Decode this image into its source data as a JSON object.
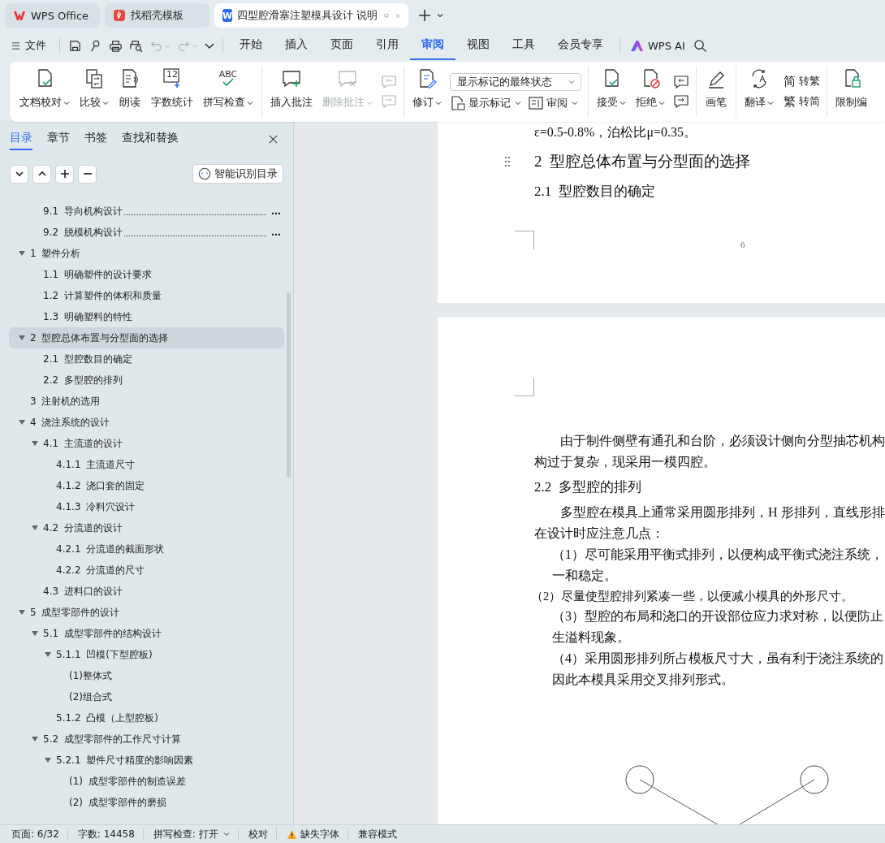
{
  "tabs": [
    {
      "label": "WPS Office",
      "selected": false,
      "kind": "wps"
    },
    {
      "label": "找稻壳模板",
      "selected": false,
      "kind": "docer"
    },
    {
      "label": "四型腔滑塞注塑模具设计 说明",
      "selected": true,
      "kind": "document",
      "logo_text": "W"
    }
  ],
  "menu": {
    "file": "文件",
    "quick_access": [
      {
        "disabled": false
      },
      {
        "disabled": false
      },
      {
        "disabled": false
      },
      {
        "disabled": false
      },
      {
        "disabled": true
      },
      {
        "disabled": true
      },
      {
        "disabled": false
      }
    ],
    "tabs": [
      {
        "label": "开始",
        "selected": false
      },
      {
        "label": "插入",
        "selected": false
      },
      {
        "label": "页面",
        "selected": false
      },
      {
        "label": "引用",
        "selected": false
      },
      {
        "label": "审阅",
        "selected": true
      },
      {
        "label": "视图",
        "selected": false
      },
      {
        "label": "工具",
        "selected": false
      },
      {
        "label": "会员专享",
        "selected": false
      }
    ],
    "ai": "WPS AI"
  },
  "ribbon": {
    "groups": [
      {
        "tools": [
          {
            "kind": "large",
            "label": "文档校对",
            "caret": true,
            "disabled": false
          },
          {
            "kind": "large",
            "label": "比较",
            "caret": true,
            "disabled": false
          },
          {
            "kind": "large",
            "label": "朗读",
            "caret": false,
            "disabled": false
          },
          {
            "kind": "large",
            "label": "字数统计",
            "caret": false,
            "disabled": false,
            "icon_text": "12"
          },
          {
            "kind": "large",
            "label": "拼写检查",
            "caret": true,
            "disabled": false,
            "icon_text": "ABC"
          }
        ]
      },
      {
        "tools": [
          {
            "kind": "large",
            "label": "插入批注",
            "caret": false,
            "disabled": false
          },
          {
            "kind": "large",
            "label": "删除批注",
            "caret": true,
            "disabled": true
          },
          {
            "kind": "stack",
            "rows": [
              [
                {
                  "kind": "icon",
                  "disabled": true
                }
              ],
              [
                {
                  "kind": "icon",
                  "disabled": true
                }
              ]
            ]
          }
        ]
      },
      {
        "tools": [
          {
            "kind": "large",
            "label": "修订",
            "caret": true,
            "disabled": false
          },
          {
            "kind": "stack",
            "rows": [
              [
                {
                  "kind": "select",
                  "value": "显示标记的最终状态"
                }
              ],
              [
                {
                  "kind": "small",
                  "label": "显示标记",
                  "caret": true,
                  "disabled": false
                },
                {
                  "kind": "small",
                  "label": "审阅",
                  "caret": true,
                  "disabled": false
                }
              ]
            ]
          }
        ]
      },
      {
        "tools": [
          {
            "kind": "large",
            "label": "接受",
            "caret": true,
            "disabled": false
          },
          {
            "kind": "large",
            "label": "拒绝",
            "caret": true,
            "disabled": false
          },
          {
            "kind": "stack",
            "rows": [
              [
                {
                  "kind": "icon",
                  "disabled": false
                }
              ],
              [
                {
                  "kind": "icon",
                  "disabled": false
                }
              ]
            ]
          }
        ]
      },
      {
        "tools": [
          {
            "kind": "large",
            "label": "画笔",
            "caret": false,
            "disabled": false
          }
        ]
      },
      {
        "tools": [
          {
            "kind": "large",
            "label": "翻译",
            "caret": true,
            "disabled": false
          },
          {
            "kind": "stack",
            "rows": [
              [
                {
                  "kind": "small",
                  "label": "转繁",
                  "caret": false,
                  "disabled": false,
                  "icon_text": "简"
                }
              ],
              [
                {
                  "kind": "small",
                  "label": "转简",
                  "caret": false,
                  "disabled": false,
                  "icon_text": "繁"
                }
              ]
            ]
          }
        ]
      },
      {
        "tools": [
          {
            "kind": "large",
            "label": "限制编",
            "caret": false,
            "disabled": false
          }
        ]
      }
    ]
  },
  "panel": {
    "tabs": [
      {
        "label": "目录",
        "selected": true
      },
      {
        "label": "章节",
        "selected": false
      },
      {
        "label": "书签",
        "selected": false
      },
      {
        "label": "查找和替换",
        "selected": false
      }
    ],
    "smart_button": "智能识别目录",
    "toc": {
      "scrolled_children": [
        {
          "label": "9.1 导向机构设计",
          "selected": false,
          "page_ref": "…"
        },
        {
          "label": "9.2 脱模机构设计",
          "selected": false,
          "page_ref": "…"
        }
      ],
      "items": [
        {
          "label": "1 塑件分析",
          "selected": false,
          "expanded": true,
          "children": [
            {
              "label": "1.1 明确塑件的设计要求",
              "selected": false
            },
            {
              "label": "1.2 计算塑件的体积和质量",
              "selected": false
            },
            {
              "label": "1.3 明确塑料的特性",
              "selected": false
            }
          ]
        },
        {
          "label": "2 型腔总体布置与分型面的选择",
          "selected": true,
          "expanded": true,
          "children": [
            {
              "label": "2.1 型腔数目的确定",
              "selected": false
            },
            {
              "label": "2.2 多型腔的排列",
              "selected": false
            }
          ]
        },
        {
          "label": "3 注射机的选用",
          "selected": false
        },
        {
          "label": "4 浇注系统的设计",
          "selected": false,
          "expanded": true,
          "children": [
            {
              "label": "4.1 主流道的设计",
              "selected": false,
              "expanded": true,
              "children": [
                {
                  "label": "4.1.1 主流道尺寸",
                  "selected": false
                },
                {
                  "label": "4.1.2 浇口套的固定",
                  "selected": false
                },
                {
                  "label": "4.1.3 冷料穴设计",
                  "selected": false
                }
              ]
            },
            {
              "label": "4.2 分流道的设计",
              "selected": false,
              "expanded": true,
              "children": [
                {
                  "label": "4.2.1 分流道的截面形状",
                  "selected": false
                },
                {
                  "label": "4.2.2 分流道的尺寸",
                  "selected": false
                }
              ]
            },
            {
              "label": "4.3 进料口的设计",
              "selected": false
            }
          ]
        },
        {
          "label": "5 成型零部件的设计",
          "selected": false,
          "expanded": true,
          "children": [
            {
              "label": "5.1 成型零部件的结构设计",
              "selected": false,
              "expanded": true,
              "children": [
                {
                  "label": "5.1.1 凹模(下型腔板)",
                  "selected": false,
                  "expanded": true,
                  "children": [
                    {
                      "label": "(1)整体式",
                      "selected": false
                    },
                    {
                      "label": "(2)组合式",
                      "selected": false
                    }
                  ]
                },
                {
                  "label": "5.1.2 凸模（上型腔板)",
                  "selected": false
                }
              ]
            },
            {
              "label": "5.2 成型零部件的工作尺寸计算",
              "selected": false,
              "expanded": true,
              "children": [
                {
                  "label": "5.2.1 塑件尺寸精度的影响因素",
                  "selected": false,
                  "expanded": true,
                  "children": [
                    {
                      "label": "(1) 成型零部件的制造误差",
                      "selected": false
                    },
                    {
                      "label": "(2) 成型零部件的磨损",
                      "selected": false
                    }
                  ]
                }
              ]
            }
          ]
        }
      ]
    }
  },
  "document": {
    "pages": [
      {
        "blocks": [
          {
            "kind": "text",
            "text": "ε=0.5-0.8%，泊松比μ=0.35。"
          },
          {
            "kind": "h1",
            "text": "2  型腔总体布置与分型面的选择"
          },
          {
            "kind": "h2",
            "text": "2.1  型腔数目的确定"
          }
        ],
        "page_number": "6"
      },
      {
        "blocks": [
          {
            "kind": "indent",
            "text": "由于制件侧壁有通孔和台阶，必须设计侧向分型抽芯机构"
          },
          {
            "kind": "text",
            "text": "构过于复杂，现采用一模四腔。"
          },
          {
            "kind": "h2",
            "text": "2.2  多型腔的排列"
          },
          {
            "kind": "indent",
            "text": "多型腔在模具上通常采用圆形排列，H 形排列，直线形排"
          },
          {
            "kind": "text",
            "text": "在设计时应注意几点："
          },
          {
            "kind": "item",
            "text": "（1）尽可能采用平衡式排列，以便构成平衡式浇注系统，"
          },
          {
            "kind": "item",
            "text": "一和稳定。"
          },
          {
            "kind": "loose",
            "text": "（2）尽量使型腔排列紧凑一些，以便减小模具的外形尺寸。"
          },
          {
            "kind": "item",
            "text": "（3）型腔的布局和浇口的开设部位应力求对称，以便防止"
          },
          {
            "kind": "item",
            "text": "生溢料现象。"
          },
          {
            "kind": "item",
            "text": "（4）采用圆形排列所占模板尺寸大，虽有利于浇注系统的"
          },
          {
            "kind": "item",
            "text": "因此本模具采用交叉排列形式。"
          },
          {
            "kind": "drawing"
          }
        ]
      }
    ]
  },
  "status": [
    {
      "kind": "text",
      "text": "页面: 6/32"
    },
    {
      "kind": "text",
      "text": "字数: 14458"
    },
    {
      "kind": "dropdown",
      "text": "拼写检查: 打开"
    },
    {
      "kind": "text",
      "text": "校对"
    },
    {
      "kind": "warning",
      "text": "缺失字体"
    },
    {
      "kind": "text",
      "text": "兼容模式"
    }
  ]
}
